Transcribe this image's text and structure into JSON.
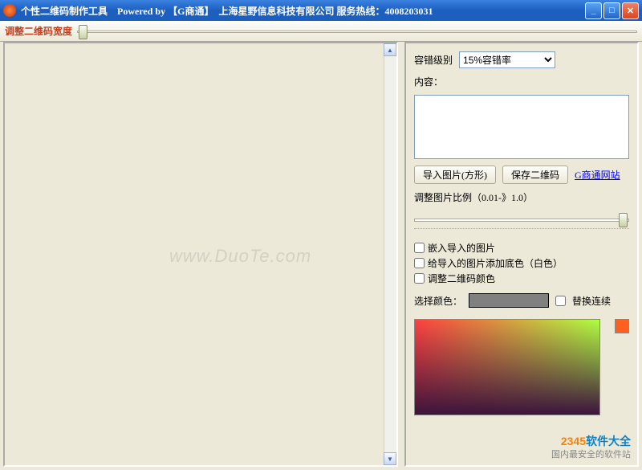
{
  "titlebar": {
    "text": "个性二维码制作工具　Powered by 【G商通】　上海星野信息科技有限公司 服务热线：4008203031"
  },
  "toolbar": {
    "width_label": "调整二维码宽度"
  },
  "watermark": "www.DuoTe.com",
  "panel": {
    "ecc_label": "容错级别",
    "ecc_value": "15%容错率",
    "content_label": "内容：",
    "content_value": "",
    "import_btn": "导入图片(方形)",
    "save_btn": "保存二维码",
    "link_text": "G商通网站",
    "ratio_label": "调整图片比例（0.01-》1.0）",
    "cb_embed": "嵌入导入的图片",
    "cb_bg": "给导入的图片添加底色（白色）",
    "cb_color": "调整二维码颜色",
    "pick_label": "选择颜色：",
    "cb_replace": "替换连续"
  },
  "footer": {
    "brand_num": "2345",
    "brand_text": "软件大全",
    "slogan": "国内最安全的软件站"
  }
}
